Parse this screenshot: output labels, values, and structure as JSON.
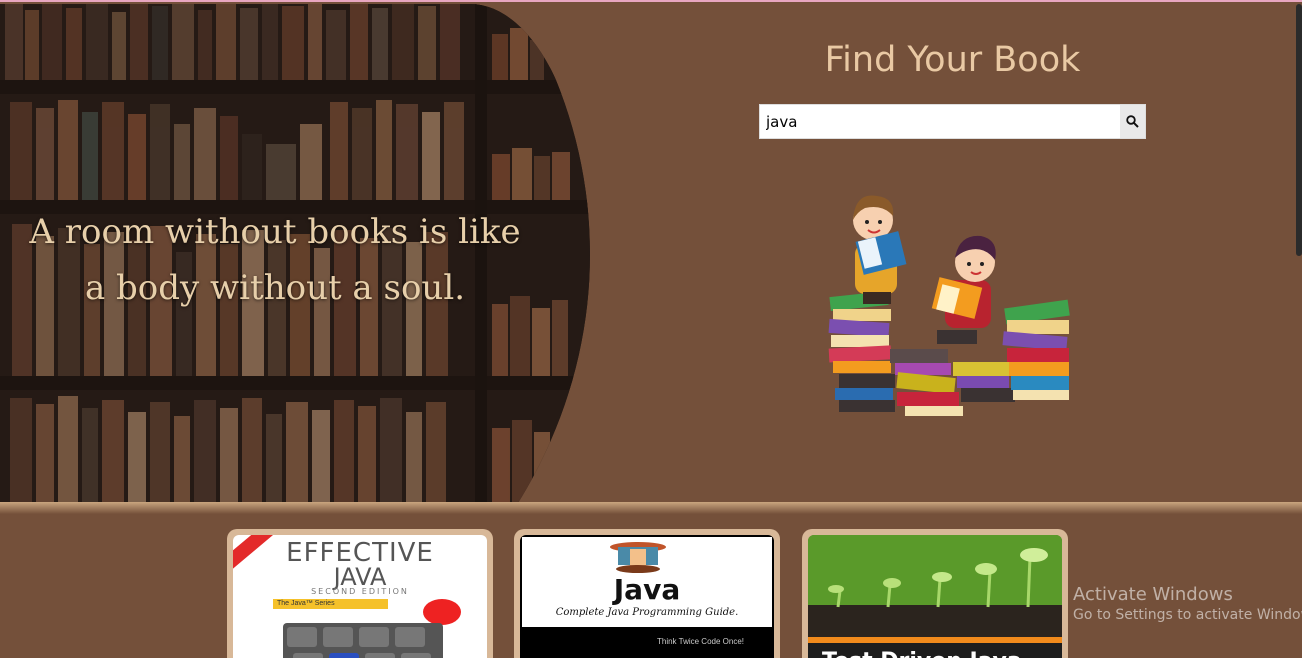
{
  "hero": {
    "quote_line1": "A room without books is like",
    "quote_line2": "a body without a soul.",
    "search_title": "Find Your Book",
    "search_value": "java"
  },
  "books": [
    {
      "title_line1": "EFFECTIVE",
      "title_line2": "JAVA",
      "edition": "SECOND EDITION",
      "series": "The Java™ Series"
    },
    {
      "title": "Java",
      "subtitle": "Complete Java Programming Guide.",
      "tagline": "Think Twice Code Once!"
    },
    {
      "title": "Test Driven Java"
    }
  ],
  "os_watermark": {
    "line1": "Activate Windows",
    "line2": "Go to Settings to activate Windows."
  },
  "colors": {
    "page_background": "#74503a",
    "title_color": "#e9c9a4",
    "card_frame": "#d8b898"
  },
  "icons": [
    "search-icon"
  ]
}
